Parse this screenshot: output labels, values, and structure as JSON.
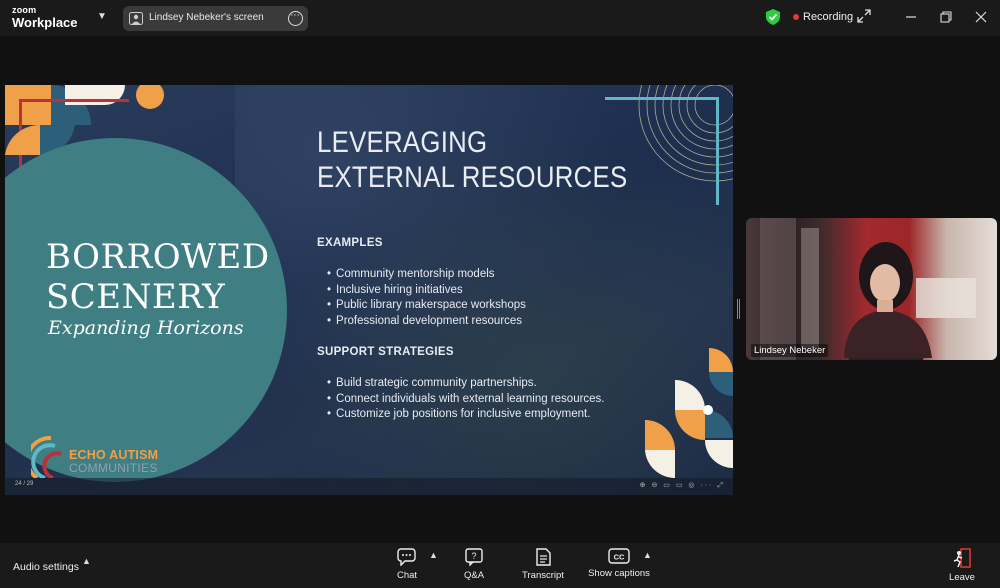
{
  "app": {
    "logo_line1": "zoom",
    "logo_line2": "Workplace"
  },
  "share_pill": {
    "label": "Lindsey Nebeker's screen"
  },
  "status": {
    "recording_label": "Recording",
    "recording_color": "#e53935",
    "shield_color": "#2ecc40"
  },
  "slide": {
    "left_title_line1": "BORROWED",
    "left_title_line2": "SCENERY",
    "left_subtitle": "Expanding Horizons",
    "title_line1": "LEVERAGING",
    "title_line2": "EXTERNAL RESOURCES",
    "section1": {
      "heading": "EXAMPLES",
      "items": [
        "Community mentorship models",
        "Inclusive hiring initiatives",
        "Public library makerspace workshops",
        "Professional development resources"
      ]
    },
    "section2": {
      "heading": "SUPPORT STRATEGIES",
      "items": [
        "Build strategic community partnerships.",
        "Connect individuals with external learning resources.",
        "Customize job positions for inclusive employment."
      ]
    },
    "logo_line1": "ECHO AUTISM",
    "logo_line2": "COMMUNITIES",
    "page_indicator": "24 / 29",
    "accent_orange": "#f0a048",
    "accent_teal": "#3f7e83"
  },
  "video": {
    "participant_name": "Lindsey Nebeker"
  },
  "toolbar": {
    "audio_settings": "Audio settings",
    "chat": "Chat",
    "qa": "Q&A",
    "transcript": "Transcript",
    "captions": "Show captions",
    "leave": "Leave"
  }
}
